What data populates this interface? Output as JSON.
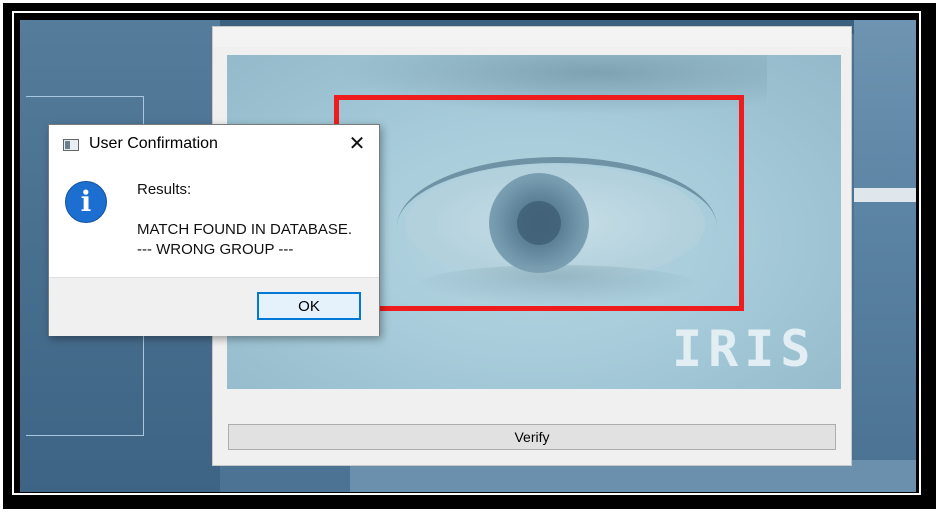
{
  "dialog": {
    "title": "User Confirmation",
    "close_glyph": "✕",
    "icon": "info-icon",
    "icon_glyph": "i",
    "message": {
      "heading": "Results:",
      "line1": "MATCH FOUND IN DATABASE.",
      "line2": "--- WRONG GROUP ---"
    },
    "ok_label": "OK"
  },
  "app": {
    "preview_overlay_text": "IRIS",
    "verify_label": "Verify"
  },
  "colors": {
    "detection_box": "#ee1c1c",
    "ok_button_border": "#0078d7",
    "info_icon": "#1c6fd1"
  }
}
